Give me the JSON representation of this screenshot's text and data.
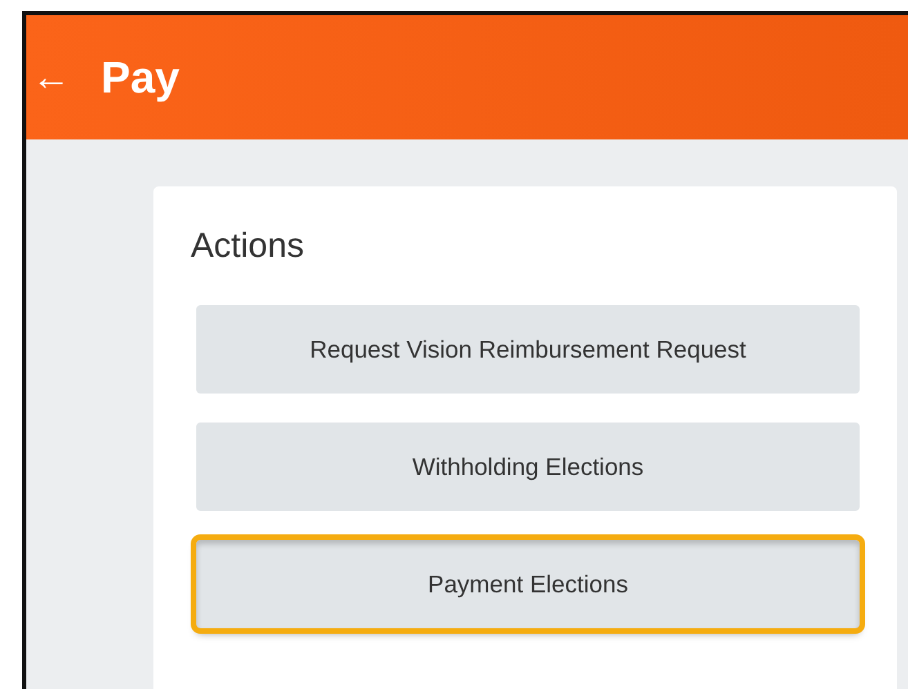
{
  "header": {
    "back_icon": "←",
    "title": "Pay"
  },
  "actions": {
    "title": "Actions",
    "buttons": [
      {
        "label": "Request Vision Reimbursement Request",
        "highlighted": false
      },
      {
        "label": "Withholding Elections",
        "highlighted": false
      },
      {
        "label": "Payment Elections",
        "highlighted": true
      }
    ]
  }
}
